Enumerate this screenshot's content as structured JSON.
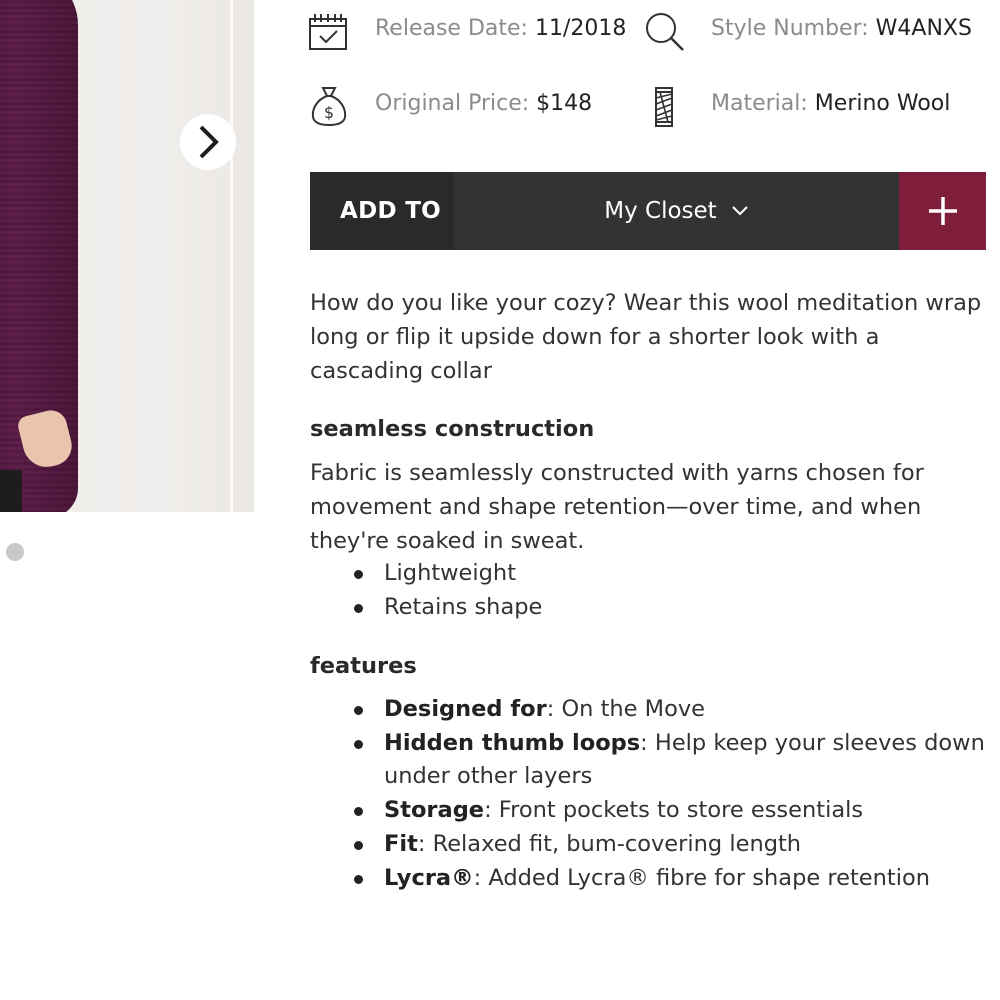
{
  "details": {
    "release_label": "Release Date:",
    "release_value": "11/2018",
    "style_label": "Style Number:",
    "style_value": "W4ANXS",
    "price_label": "Original Price:",
    "price_value": "$148",
    "material_label": "Material:",
    "material_value": "Merino Wool",
    "icons": [
      "calendar-icon",
      "search-icon",
      "money-bag-icon",
      "yarn-spool-icon"
    ]
  },
  "gallery": {
    "next_icon": "chevron-right-icon",
    "dots": 1
  },
  "add_bar": {
    "add_to_label": "ADD TO",
    "selected_list": "My Closet",
    "dropdown_icon": "chevron-down-icon",
    "plus_icon": "plus-icon",
    "accent_color": "#7f1e3b"
  },
  "description": "How do you like your cozy? Wear this wool meditation wrap long or flip it upside down for a shorter look with a cascading collar",
  "seamless": {
    "heading": "seamless construction",
    "text": "Fabric is seamlessly constructed with yarns chosen for movement and shape retention—over time, and when they're soaked in sweat.",
    "bullets": [
      "Lightweight",
      "Retains shape"
    ]
  },
  "features": {
    "heading": "features",
    "items": [
      {
        "label": "Designed for",
        "text": ": On the Move"
      },
      {
        "label": "Hidden thumb loops",
        "text": ": Help keep your sleeves down under other layers"
      },
      {
        "label": "Storage",
        "text": ": Front pockets to store essentials"
      },
      {
        "label": "Fit",
        "text": ": Relaxed fit, bum-covering length"
      },
      {
        "label": "Lycra®",
        "text": ": Added Lycra® fibre for shape retention"
      }
    ]
  }
}
